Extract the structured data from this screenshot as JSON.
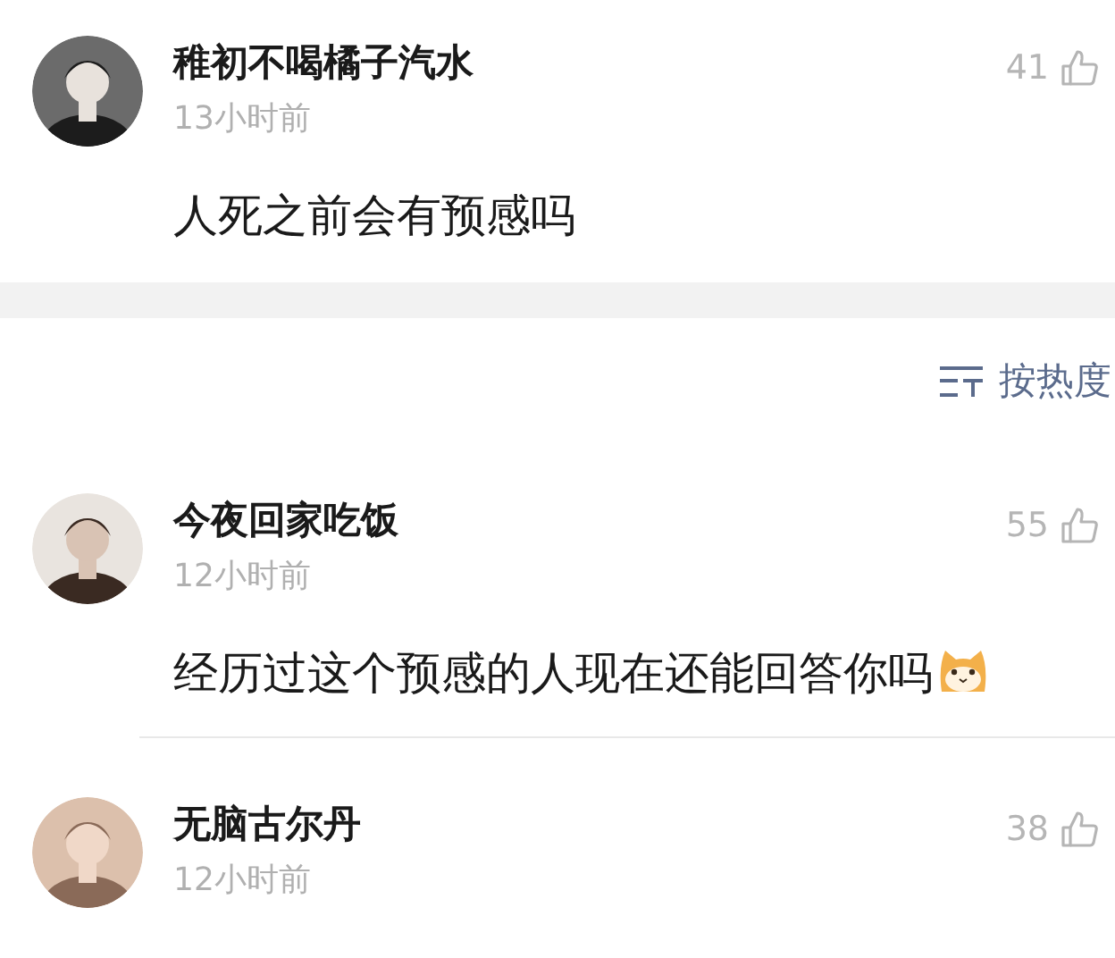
{
  "top_comment": {
    "author": "稚初不喝橘子汽水",
    "time": "13小时前",
    "likes": "41",
    "text": "人死之前会有预感吗"
  },
  "sort": {
    "label": "按热度"
  },
  "replies": [
    {
      "author": "今夜回家吃饭",
      "time": "12小时前",
      "likes": "55",
      "text": "经历过这个预感的人现在还能回答你吗",
      "trailing_emoji": true
    },
    {
      "author": "无脑古尔丹",
      "time": "12小时前",
      "likes": "38",
      "trailing_emoji": false
    }
  ]
}
